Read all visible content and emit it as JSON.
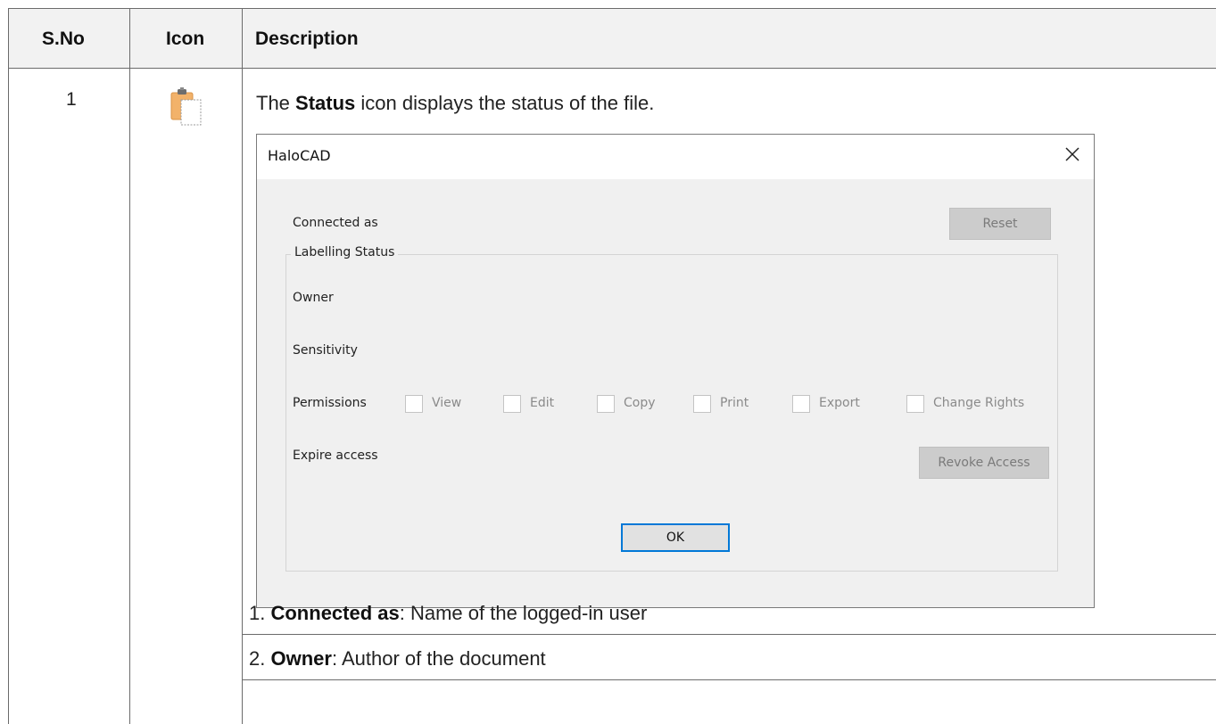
{
  "table": {
    "headers": {
      "sno": "S.No",
      "icon": "Icon",
      "description": "Description"
    },
    "row": {
      "sno": "1",
      "icon": "clipboard-icon",
      "intro": {
        "pre": "The ",
        "bold": "Status",
        "post": " icon displays the status of the file."
      },
      "list": [
        {
          "num": "1.",
          "bold": "Connected as",
          "text": ": Name of the logged-in user"
        },
        {
          "num": "2.",
          "bold": "Owner",
          "text": ": Author of the document"
        }
      ]
    }
  },
  "dialog": {
    "title": "HaloCAD",
    "connected_as": "Connected as",
    "reset_button": "Reset",
    "group_label": "Labelling Status",
    "owner": "Owner",
    "sensitivity": "Sensitivity",
    "permissions": "Permissions",
    "checkboxes": [
      {
        "label": "View",
        "checked": false
      },
      {
        "label": "Edit",
        "checked": false
      },
      {
        "label": "Copy",
        "checked": false
      },
      {
        "label": "Print",
        "checked": false
      },
      {
        "label": "Export",
        "checked": false
      },
      {
        "label": "Change Rights",
        "checked": false
      }
    ],
    "expire_access": "Expire access",
    "revoke_button": "Revoke Access",
    "ok_button": "OK"
  }
}
